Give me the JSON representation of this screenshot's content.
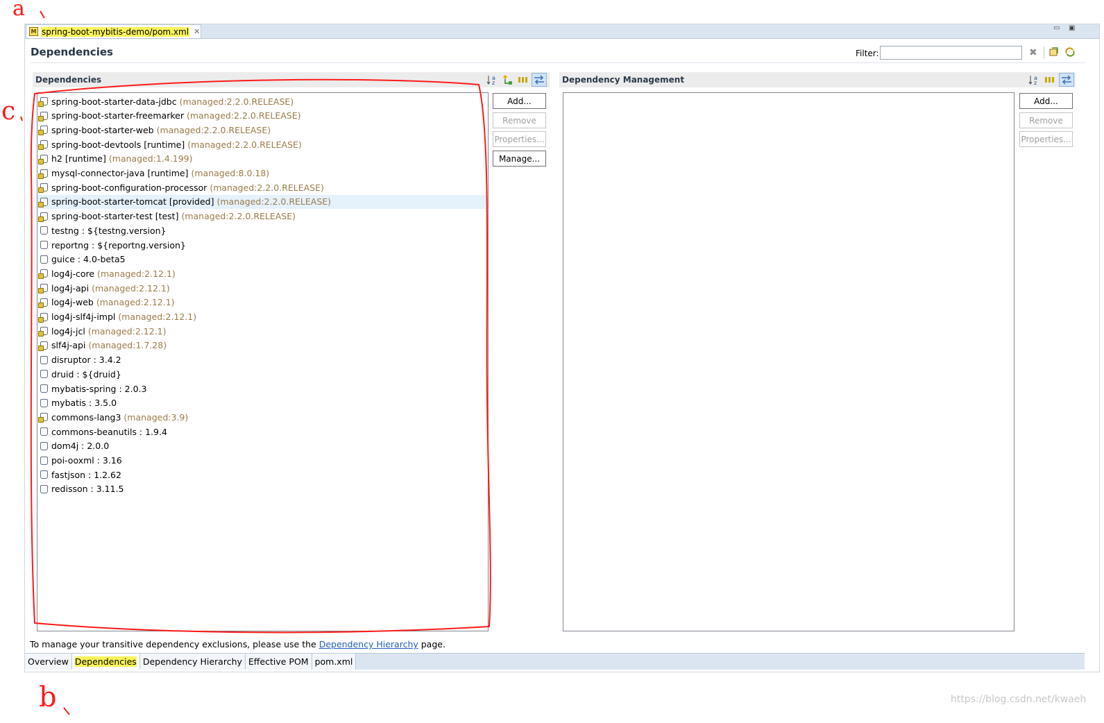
{
  "editor_tab": {
    "icon": "M",
    "title": "spring-boot-mybitis-demo/pom.xml",
    "close": "✕"
  },
  "window_controls": {
    "minimize": "▭",
    "maximize": "▣"
  },
  "page_title": "Dependencies",
  "filter": {
    "label": "Filter:",
    "value": ""
  },
  "dependencies": {
    "header": "Dependencies",
    "buttons": {
      "add": "Add...",
      "remove": "Remove",
      "properties": "Properties...",
      "manage": "Manage..."
    },
    "items": [
      {
        "name": "spring-boot-starter-data-jdbc",
        "managed": "(managed:2.2.0.RELEASE)"
      },
      {
        "name": "spring-boot-starter-freemarker",
        "managed": "(managed:2.2.0.RELEASE)"
      },
      {
        "name": "spring-boot-starter-web",
        "managed": "(managed:2.2.0.RELEASE)"
      },
      {
        "name": "spring-boot-devtools [runtime]",
        "managed": "(managed:2.2.0.RELEASE)"
      },
      {
        "name": "h2 [runtime]",
        "managed": "(managed:1.4.199)"
      },
      {
        "name": "mysql-connector-java [runtime]",
        "managed": "(managed:8.0.18)"
      },
      {
        "name": "spring-boot-configuration-processor",
        "managed": "(managed:2.2.0.RELEASE)"
      },
      {
        "name": "spring-boot-starter-tomcat [provided]",
        "managed": "(managed:2.2.0.RELEASE)"
      },
      {
        "name": "spring-boot-starter-test [test]",
        "managed": "(managed:2.2.0.RELEASE)"
      },
      {
        "name": "testng : ${testng.version}",
        "managed": ""
      },
      {
        "name": "reportng : ${reportng.version}",
        "managed": ""
      },
      {
        "name": "guice : 4.0-beta5",
        "managed": ""
      },
      {
        "name": "log4j-core",
        "managed": "(managed:2.12.1)"
      },
      {
        "name": "log4j-api",
        "managed": "(managed:2.12.1)"
      },
      {
        "name": "log4j-web",
        "managed": "(managed:2.12.1)"
      },
      {
        "name": "log4j-slf4j-impl",
        "managed": "(managed:2.12.1)"
      },
      {
        "name": "log4j-jcl",
        "managed": "(managed:2.12.1)"
      },
      {
        "name": "slf4j-api",
        "managed": "(managed:1.7.28)"
      },
      {
        "name": "disruptor : 3.4.2",
        "managed": ""
      },
      {
        "name": "druid : ${druid}",
        "managed": ""
      },
      {
        "name": "mybatis-spring : 2.0.3",
        "managed": ""
      },
      {
        "name": "mybatis : 3.5.0",
        "managed": ""
      },
      {
        "name": "commons-lang3",
        "managed": "(managed:3.9)"
      },
      {
        "name": "commons-beanutils : 1.9.4",
        "managed": ""
      },
      {
        "name": "dom4j : 2.0.0",
        "managed": ""
      },
      {
        "name": "poi-ooxml : 3.16",
        "managed": ""
      },
      {
        "name": "fastjson : 1.2.62",
        "managed": ""
      },
      {
        "name": "redisson : 3.11.5",
        "managed": ""
      }
    ]
  },
  "dependency_management": {
    "header": "Dependency Management",
    "buttons": {
      "add": "Add...",
      "remove": "Remove",
      "properties": "Properties..."
    }
  },
  "hint": {
    "prefix": "To manage your transitive dependency exclusions, please use the ",
    "link": "Dependency Hierarchy",
    "suffix": " page."
  },
  "bottom_tabs": [
    "Overview",
    "Dependencies",
    "Dependency Hierarchy",
    "Effective POM",
    "pom.xml"
  ],
  "annotations": {
    "a": "a",
    "b": "b",
    "c": "c"
  },
  "watermark": "https://blog.csdn.net/kwaeh",
  "colors": {
    "annotation_red": "#ff1a1a",
    "highlight_yellow": "#f8f45a",
    "link_blue": "#1f5fbf",
    "managed_text": "#9b7b4a"
  }
}
